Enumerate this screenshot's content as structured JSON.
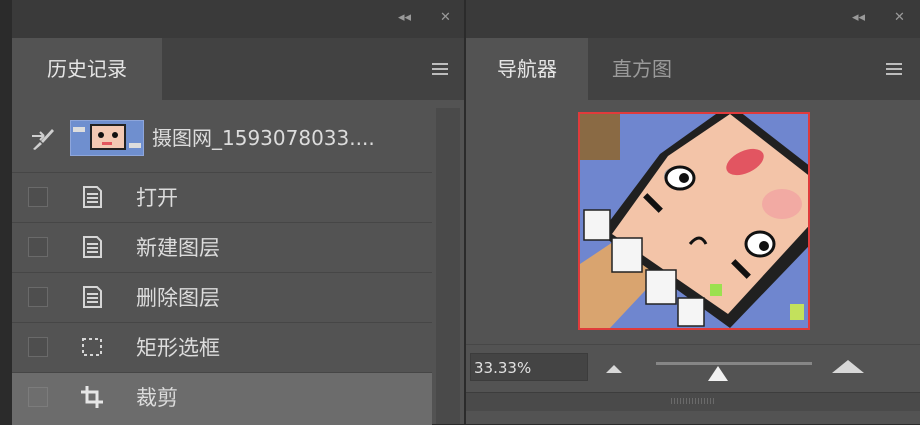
{
  "history_panel": {
    "collapse_glyph": "◂◂",
    "close_glyph": "✕",
    "tab_label": "历史记录",
    "snapshot_label": "摄图网_1593078033....",
    "snapshot_icon": "brush-icon",
    "items": [
      {
        "label": "打开",
        "icon": "document-icon"
      },
      {
        "label": "新建图层",
        "icon": "document-icon"
      },
      {
        "label": "删除图层",
        "icon": "document-icon"
      },
      {
        "label": "矩形选框",
        "icon": "marquee-icon"
      },
      {
        "label": "裁剪",
        "icon": "crop-icon",
        "selected": true
      }
    ]
  },
  "navigator_panel": {
    "collapse_glyph": "◂◂",
    "close_glyph": "✕",
    "tabs": [
      {
        "label": "导航器",
        "active": true
      },
      {
        "label": "直方图",
        "active": false
      }
    ],
    "zoom_value": "33.33%",
    "zoom_slider_level": 0.4,
    "view_box_color": "#e03b3b"
  }
}
